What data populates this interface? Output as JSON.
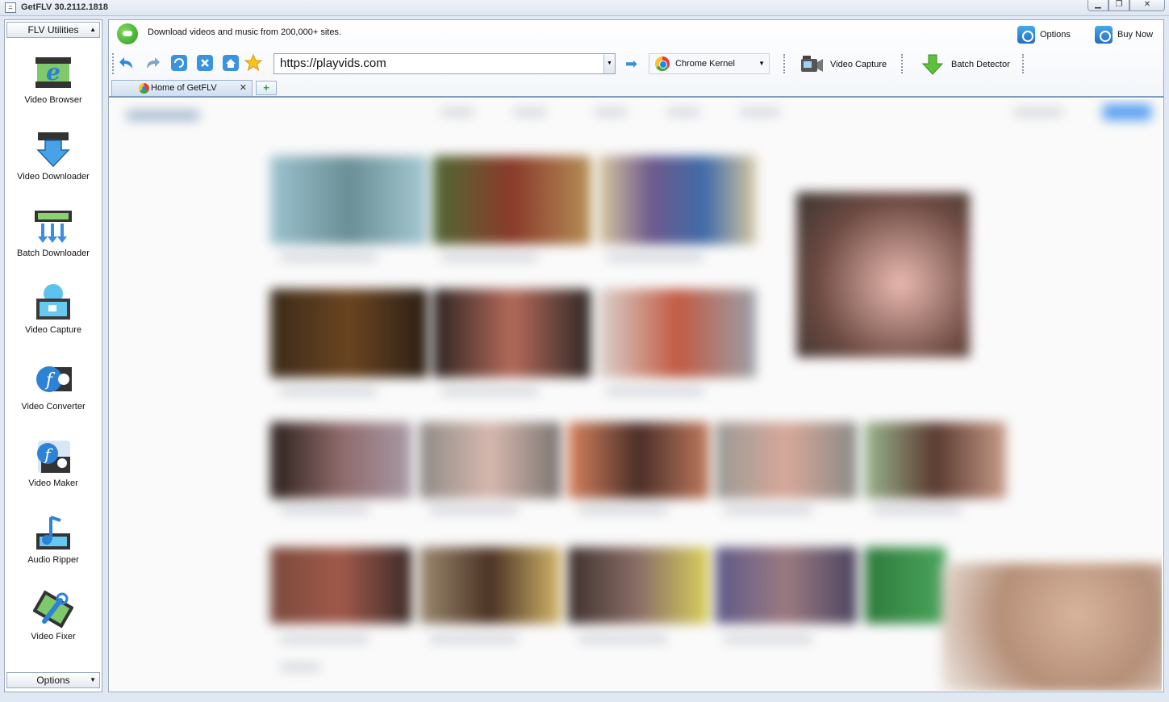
{
  "window": {
    "title": "GetFLV 30.2112.1818"
  },
  "sidebar": {
    "top_dropdown": "FLV Utilities",
    "bottom_dropdown": "Options",
    "tools": [
      {
        "label": "Video Browser",
        "icon": "video-browser-icon"
      },
      {
        "label": "Video Downloader",
        "icon": "video-downloader-icon"
      },
      {
        "label": "Batch Downloader",
        "icon": "batch-downloader-icon"
      },
      {
        "label": "Video Capture",
        "icon": "video-capture-icon"
      },
      {
        "label": "Video Converter",
        "icon": "video-converter-icon"
      },
      {
        "label": "Video Maker",
        "icon": "video-maker-icon"
      },
      {
        "label": "Audio Ripper",
        "icon": "audio-ripper-icon"
      },
      {
        "label": "Video Fixer",
        "icon": "video-fixer-icon"
      }
    ]
  },
  "header": {
    "tagline": "Download videos and music from 200,000+ sites.",
    "options_label": "Options",
    "buy_label": "Buy Now"
  },
  "navbar": {
    "url": "https://playvids.com",
    "kernel": "Chrome Kernel",
    "video_capture_label": "Video Capture",
    "batch_detector_label": "Batch Detector"
  },
  "tabs": [
    {
      "label": "Home of GetFLV"
    }
  ],
  "colors": {
    "accent": "#2f7ad1",
    "sidebar_border": "#9aaabd",
    "tab_border": "#7c9cc4"
  }
}
